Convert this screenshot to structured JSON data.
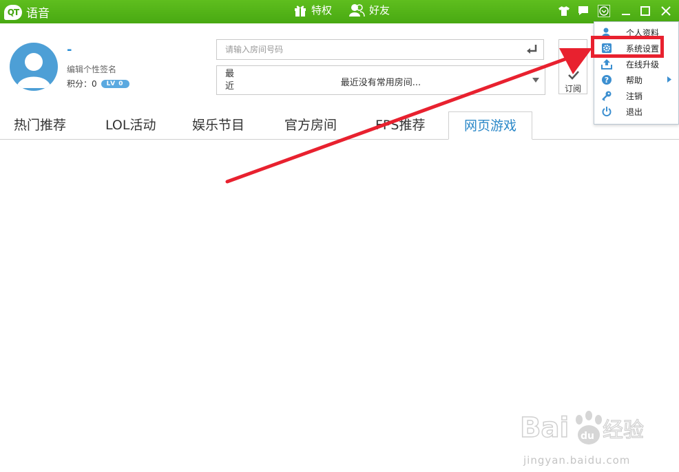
{
  "app": {
    "logo_badge": "QT",
    "title": "语音"
  },
  "topnav": {
    "privilege": "特权",
    "friends": "好友"
  },
  "profile": {
    "nickname": "-",
    "signature": "编辑个性签名",
    "score_text": "积分：0",
    "level": "LV 0"
  },
  "search": {
    "placeholder": "请输入房间号码"
  },
  "recent": {
    "label": "最近",
    "empty_text": "最近没有常用房间..."
  },
  "subscribe": {
    "label": "订阅"
  },
  "tabs": [
    {
      "label": "热门推荐"
    },
    {
      "label": "LOL活动"
    },
    {
      "label": "娱乐节目"
    },
    {
      "label": "官方房间"
    },
    {
      "label": "FPS推荐"
    },
    {
      "label": "网页游戏",
      "active": true
    }
  ],
  "menu": {
    "items": [
      {
        "label": "个人资料",
        "icon": "user-icon"
      },
      {
        "label": "系统设置",
        "icon": "gear-icon",
        "highlighted": true
      },
      {
        "label": "在线升级",
        "icon": "upload-icon"
      },
      {
        "label": "帮助",
        "icon": "help-icon",
        "has_submenu": true
      },
      {
        "label": "注销",
        "icon": "key-icon"
      },
      {
        "label": "退出",
        "icon": "power-icon"
      }
    ]
  },
  "colors": {
    "titlebar": "#4fb318",
    "accent_blue": "#2b88c8",
    "annotation_red": "#e8212f",
    "icon_blue": "#3c8fd0"
  },
  "watermark": {
    "text": "jingyan.baidu.com"
  }
}
